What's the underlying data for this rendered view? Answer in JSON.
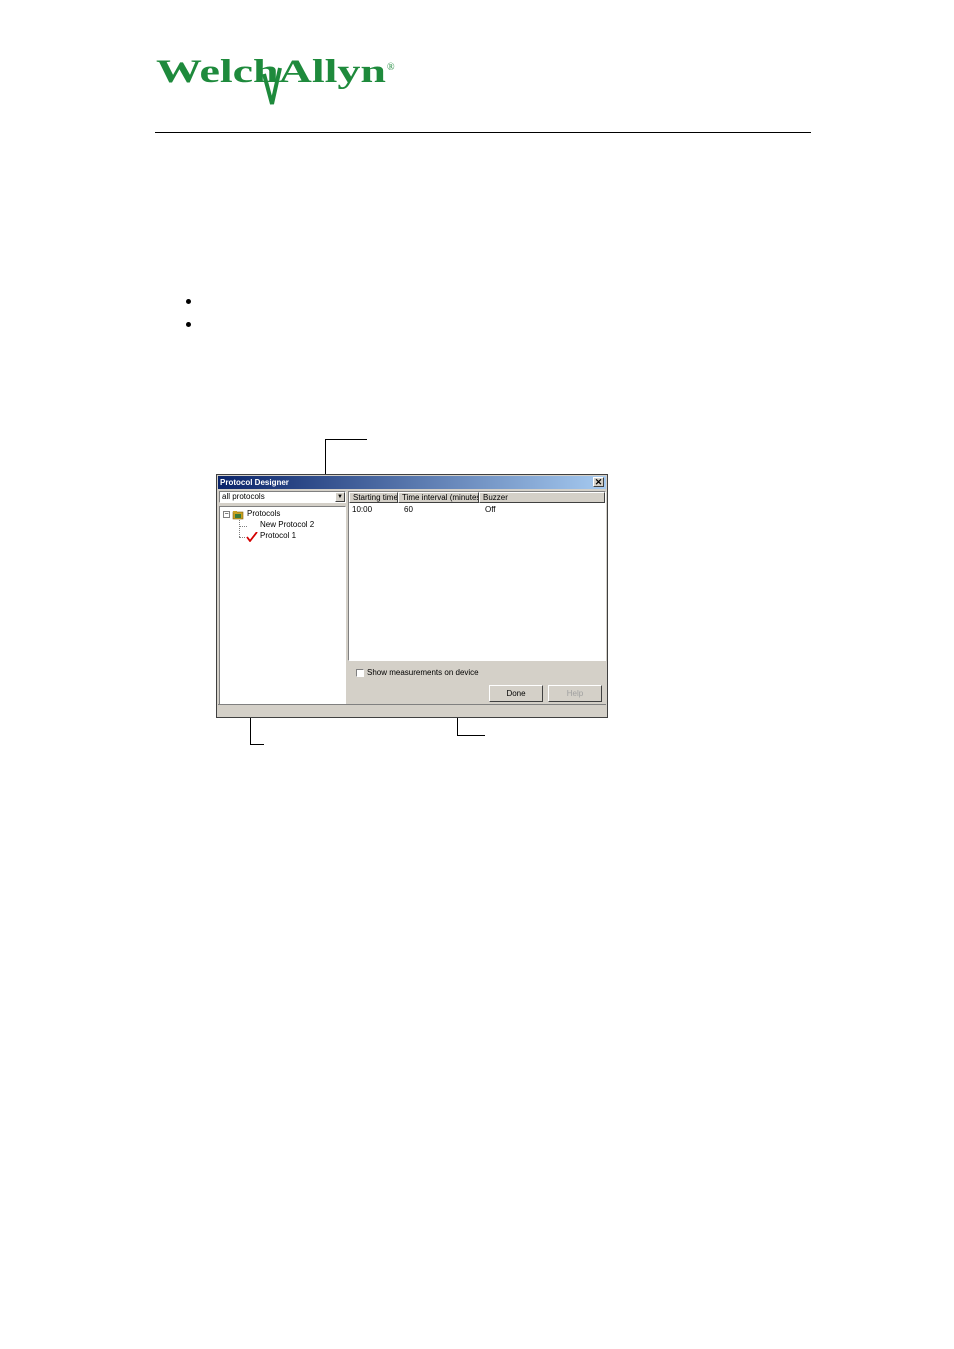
{
  "logo": {
    "text": "WelchAllyn",
    "registered_mark": "®",
    "color": "#1e8a3c"
  },
  "dialog": {
    "title": "Protocol Designer",
    "close_glyph": "✕",
    "filter_value": "all protocols",
    "dropdown_glyph": "▼",
    "tree": {
      "expander_glyph": "−",
      "root_label": "Protocols",
      "items": [
        "New Protocol 2",
        "Protocol 1"
      ]
    },
    "grid": {
      "columns": [
        "Starting time",
        "Time interval (minutes)",
        "Buzzer"
      ],
      "rows": [
        [
          "10:00",
          "60",
          "Off"
        ]
      ]
    },
    "checkbox_label": "Show measurements on device",
    "buttons": {
      "done": "Done",
      "help": "Help"
    }
  },
  "colors": {
    "accent": "#0a246a",
    "check_mark": "#d40000"
  }
}
